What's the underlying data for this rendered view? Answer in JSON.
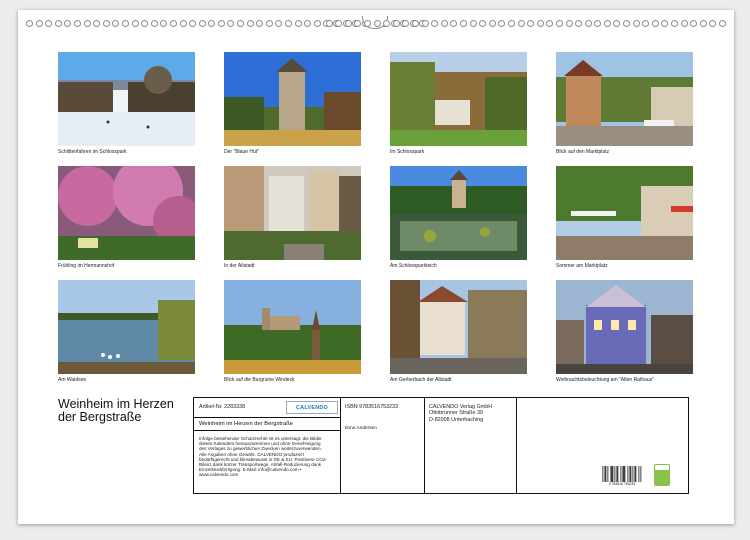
{
  "photos": [
    {
      "caption": "Schlittenfahren im Schlosspark"
    },
    {
      "caption": "Der \"Blaue Hut\""
    },
    {
      "caption": "Im Schlosspark"
    },
    {
      "caption": "Blick auf den Marktplatz"
    },
    {
      "caption": "Frühling im Hermannshof"
    },
    {
      "caption": "In der Altstadt"
    },
    {
      "caption": "Am Schlossparkteich"
    },
    {
      "caption": "Sommer am Marktplatz"
    },
    {
      "caption": "Am Waidsee"
    },
    {
      "caption": "Blick auf die Burgruine Windeck"
    },
    {
      "caption": "Am Gerberbach der Altstadt"
    },
    {
      "caption": "Weihnachtsbeleuchtung am \"Alten Rathaus\""
    }
  ],
  "title": {
    "line1": "Weinheim im Herzen",
    "line2": "der Bergstraße"
  },
  "info": {
    "artnr": "Artikel-Nr. 2283338",
    "logo": "CALVENDO",
    "calendar_title": "Weinheim im Herzen der Bergstraße",
    "disclaimer": "Infolge bestehender Schutzrechte ist es untersagt, die Bilder dieses Kalenders herauszutrennen und ohne Genehmigung des Verlages zu gewerblichen Zwecken weiterzuverwenden. Alle Angaben ohne Gewähr. CALVENDO produziert bedarfsgerecht und klimabewusst in DE & EU. Positivere CO2-Bilanz dank kürzer Transportwege. Abfall-Reduzierung dank Einzelstückfertigung. E-Mail: info@calvendo.com • www.calvendo.com",
    "isbn": "ISBN 9783516753233",
    "author": "Ilona Andersen",
    "publisher_name": "CALVENDO Verlag GmbH",
    "publisher_street": "Ottobrunner Straße 39",
    "publisher_city": "D-82008 Unterhaching",
    "barcode_number": "9 783516 753233"
  },
  "colors": {
    "eco_badge": "#8bc34a",
    "logo_blue": "#1d79b6"
  }
}
